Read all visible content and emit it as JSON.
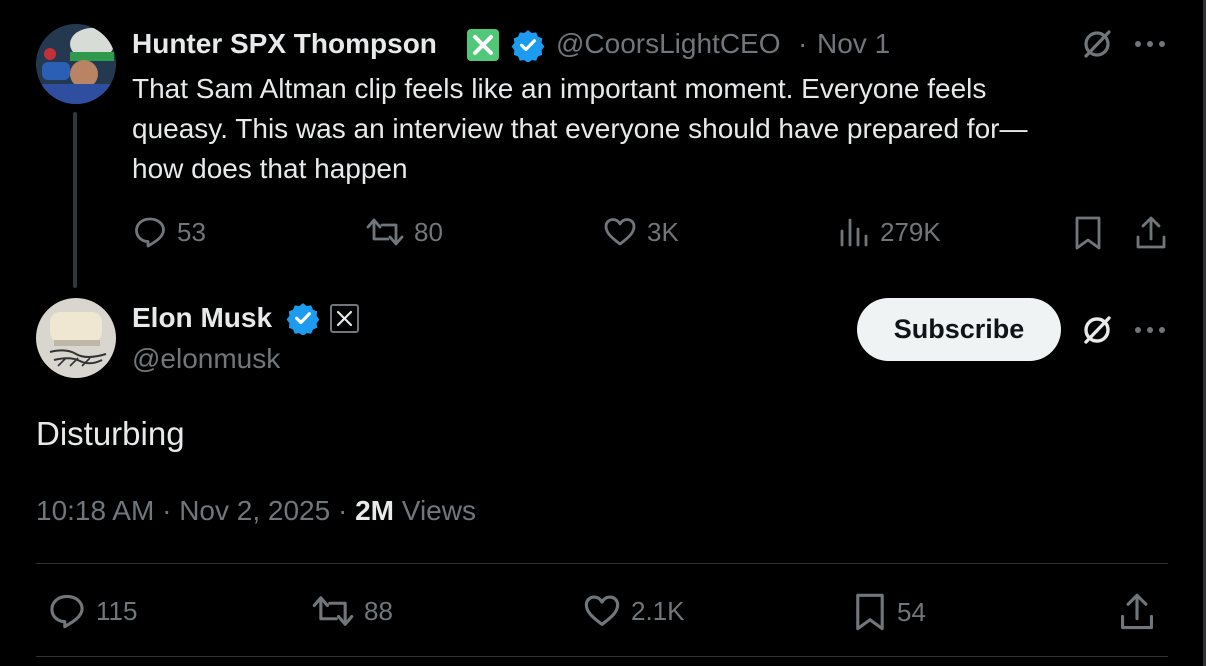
{
  "parent_tweet": {
    "author_name": "Hunter SPX Thompson",
    "handle": "@CoorsLightCEO",
    "separator": "·",
    "date": "Nov 1",
    "text_lines": [
      "That Sam Altman clip feels like an important moment. Everyone feels",
      "queasy. This was an interview that everyone should have prepared for—",
      "how does that happen"
    ],
    "replies": "53",
    "reposts": "80",
    "likes": "3K",
    "views": "279K"
  },
  "main_tweet": {
    "author_name": "Elon Musk",
    "handle": "@elonmusk",
    "subscribe_label": "Subscribe",
    "text": "Disturbing",
    "time": "10:18 AM",
    "sep1": "·",
    "date": "Nov 2, 2025",
    "sep2": "·",
    "views_count": "2M",
    "views_label": "Views",
    "replies": "115",
    "reposts": "88",
    "likes": "2.1K",
    "bookmarks": "54"
  },
  "colors": {
    "background": "#000000",
    "text": "#e7e9ea",
    "muted": "#71767b",
    "verified": "#1d9bf0",
    "x_badge_green": "#50c878"
  }
}
